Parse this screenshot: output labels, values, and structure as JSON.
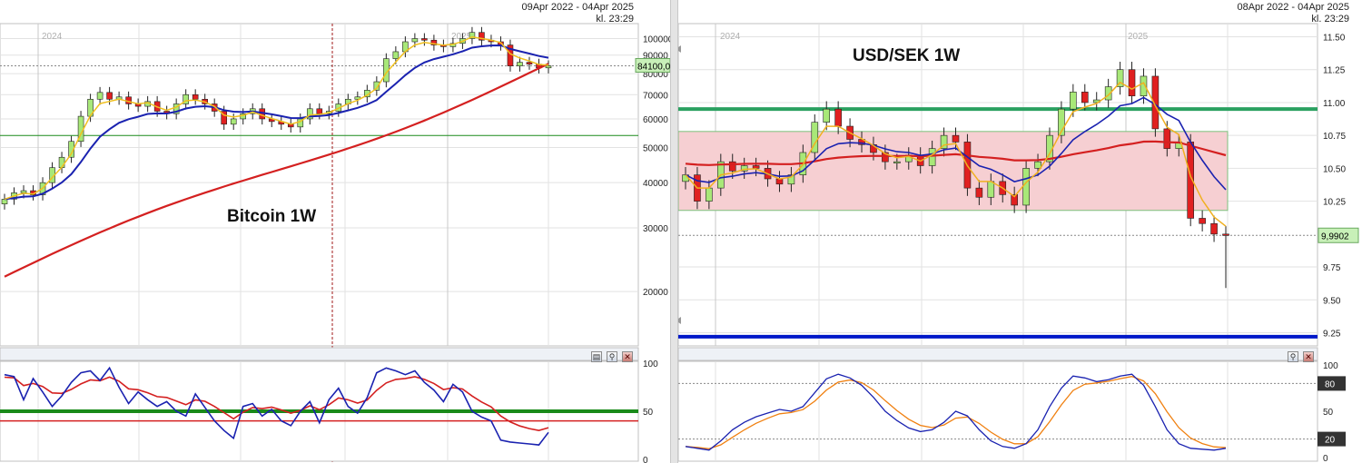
{
  "left": {
    "header": {
      "range": "09Apr 2022 - 04Apr 2025",
      "time": "kl. 23:29"
    },
    "title": "Bitcoin 1W",
    "years": [
      "2024",
      "2025"
    ],
    "price_ticks": [
      "100000",
      "90000",
      "80000",
      "70000",
      "60000",
      "50000",
      "40000",
      "30000",
      "20000"
    ],
    "last_price": "84100,0",
    "osc_ticks": [
      "100",
      "50",
      "0"
    ],
    "colors": {
      "fast_ma": "#f0c020",
      "mid_ma": "#1a22b0",
      "slow_ma": "#d42020",
      "band": "#1a8a1a",
      "up": "#a8e878",
      "down": "#e02020"
    }
  },
  "right": {
    "header": {
      "range": "08Apr 2022 - 04Apr 2025",
      "time": "kl. 23:29"
    },
    "title": "USD/SEK 1W",
    "years": [
      "2024",
      "2025"
    ],
    "price_ticks": [
      "11.50",
      "11.25",
      "11.00",
      "10.75",
      "10.50",
      "10.25",
      "9.75",
      "9.50",
      "9.25"
    ],
    "last_price": "9,9902",
    "osc_ticks": [
      "100",
      "50",
      "0"
    ],
    "osc_levels": [
      "80",
      "20"
    ],
    "colors": {
      "fast_ma": "#f0b020",
      "mid_ma": "#1a22b0",
      "slow_ma": "#d42020",
      "band": "#2aa060",
      "support": "#0018c8",
      "zone": "#f6cfd2"
    }
  },
  "chart_data": [
    {
      "type": "candlestick",
      "title": "Bitcoin 1W",
      "x": "weekly",
      "x_year_labels": [
        "2024",
        "2025"
      ],
      "ylim": [
        15000,
        110000
      ],
      "y_scale": "log",
      "close_approx": [
        36000,
        37500,
        38000,
        37000,
        40000,
        44000,
        47000,
        52000,
        61000,
        68000,
        71000,
        68000,
        69000,
        66000,
        65000,
        67000,
        63000,
        62000,
        66000,
        70000,
        68000,
        66000,
        63000,
        58000,
        60000,
        62000,
        64000,
        60000,
        59000,
        58000,
        57000,
        60000,
        64000,
        62000,
        63000,
        66000,
        68000,
        69000,
        72000,
        76000,
        88000,
        92000,
        98000,
        100000,
        99000,
        96000,
        95000,
        97000,
        100000,
        104000,
        99000,
        98000,
        96000,
        84000,
        86000,
        85000,
        83000,
        84100
      ],
      "last_price": 84100,
      "oscillator": {
        "range": [
          0,
          100
        ],
        "levels": [
          50,
          40
        ]
      }
    },
    {
      "type": "candlestick",
      "title": "USD/SEK 1W",
      "x": "weekly",
      "x_year_labels": [
        "2024",
        "2025"
      ],
      "ylim": [
        9.15,
        11.6
      ],
      "close_approx": [
        10.45,
        10.25,
        10.35,
        10.55,
        10.48,
        10.52,
        10.5,
        10.42,
        10.38,
        10.45,
        10.62,
        10.85,
        10.95,
        10.82,
        10.72,
        10.68,
        10.62,
        10.55,
        10.55,
        10.6,
        10.52,
        10.65,
        10.75,
        10.7,
        10.35,
        10.28,
        10.4,
        10.3,
        10.22,
        10.5,
        10.55,
        10.75,
        10.95,
        11.08,
        11.0,
        11.02,
        11.12,
        11.25,
        11.05,
        11.2,
        10.8,
        10.65,
        10.7,
        10.12,
        10.08,
        10.0,
        9.99
      ],
      "last_price": 9.9902,
      "horizontal_lines": [
        10.95,
        9.22
      ],
      "zone": [
        10.18,
        10.78
      ],
      "oscillator": {
        "range": [
          0,
          100
        ],
        "levels": [
          80,
          20
        ]
      }
    }
  ]
}
